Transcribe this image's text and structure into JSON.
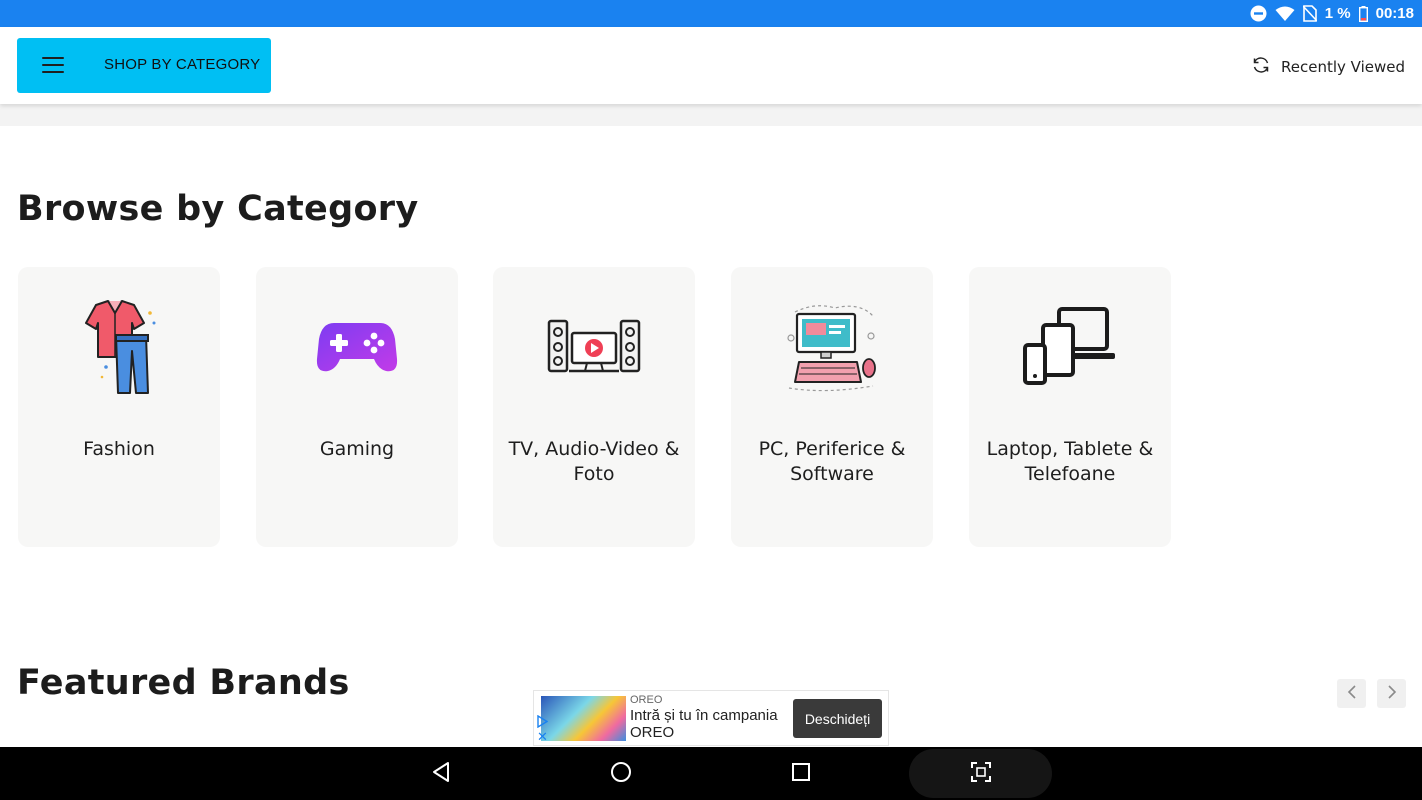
{
  "status_bar": {
    "battery_text": "1 %",
    "time": "00:18",
    "color": "#1a82f0"
  },
  "header": {
    "shop_button_label": "SHOP BY CATEGORY",
    "recently_viewed_label": "Recently Viewed",
    "accent_color": "#00bff3"
  },
  "browse": {
    "title": "Browse by Category",
    "categories": [
      {
        "label": "Fashion",
        "icon": "clothes-icon"
      },
      {
        "label": "Gaming",
        "icon": "gamepad-icon"
      },
      {
        "label": "TV, Audio-Video & Foto",
        "icon": "home-theater-icon"
      },
      {
        "label": "PC, Periferice & Software",
        "icon": "computer-icon"
      },
      {
        "label": "Laptop, Tablete & Telefoane",
        "icon": "devices-icon"
      }
    ]
  },
  "featured": {
    "title": "Featured Brands"
  },
  "ad": {
    "brand": "OREO",
    "headline": "Intră și tu în campania",
    "brand_line": "OREO",
    "cta": "Deschideți",
    "close": "✕"
  },
  "nav": {
    "icons": [
      "back-icon",
      "home-icon",
      "recents-icon",
      "screenshot-icon"
    ]
  }
}
